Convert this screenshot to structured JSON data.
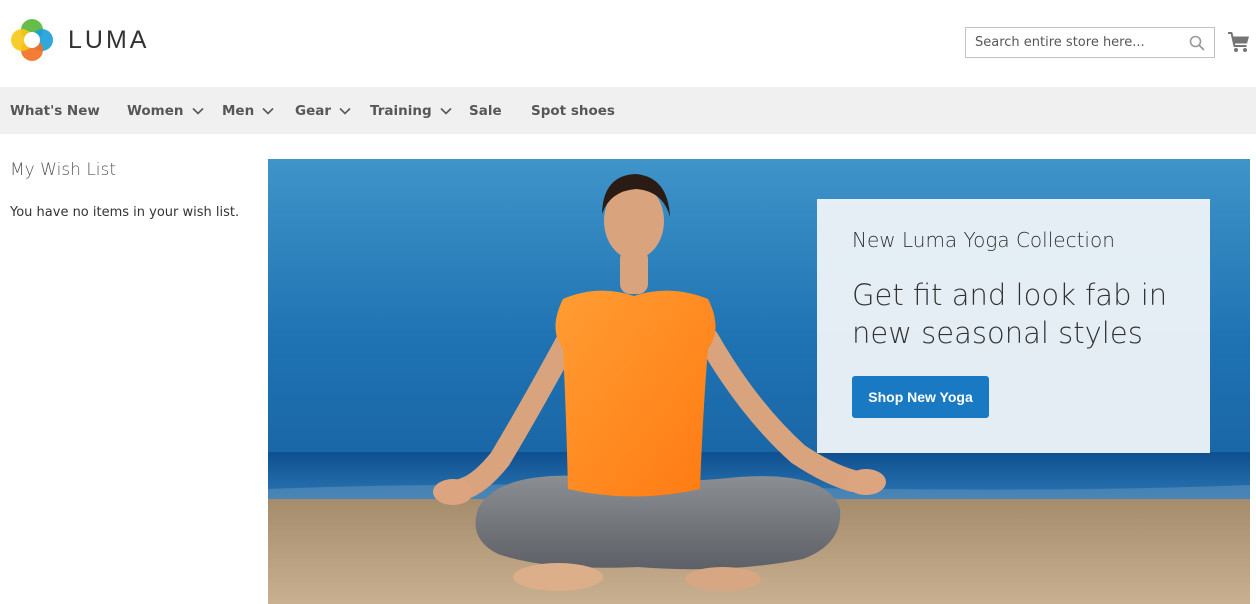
{
  "header": {
    "logo_text": "LUMA",
    "search": {
      "placeholder": "Search entire store here...",
      "value": ""
    },
    "cart_icon": "cart-icon",
    "search_icon": "search-icon"
  },
  "nav": {
    "items": [
      {
        "label": "What's New",
        "has_submenu": false
      },
      {
        "label": "Women",
        "has_submenu": true
      },
      {
        "label": "Men",
        "has_submenu": true
      },
      {
        "label": "Gear",
        "has_submenu": true
      },
      {
        "label": "Training",
        "has_submenu": true
      },
      {
        "label": "Sale",
        "has_submenu": false
      },
      {
        "label": "Spot shoes",
        "has_submenu": false
      }
    ]
  },
  "sidebar": {
    "title": "My Wish List",
    "empty_message": "You have no items in your wish list."
  },
  "hero": {
    "subtitle": "New Luma Yoga Collection",
    "headline": "Get fit and look fab in new seasonal styles",
    "button_label": "Shop New Yoga"
  },
  "colors": {
    "nav_bg": "#f0f0f0",
    "accent": "#1979c3",
    "promo_bg": "#ecf2f7",
    "text": "#333333"
  }
}
